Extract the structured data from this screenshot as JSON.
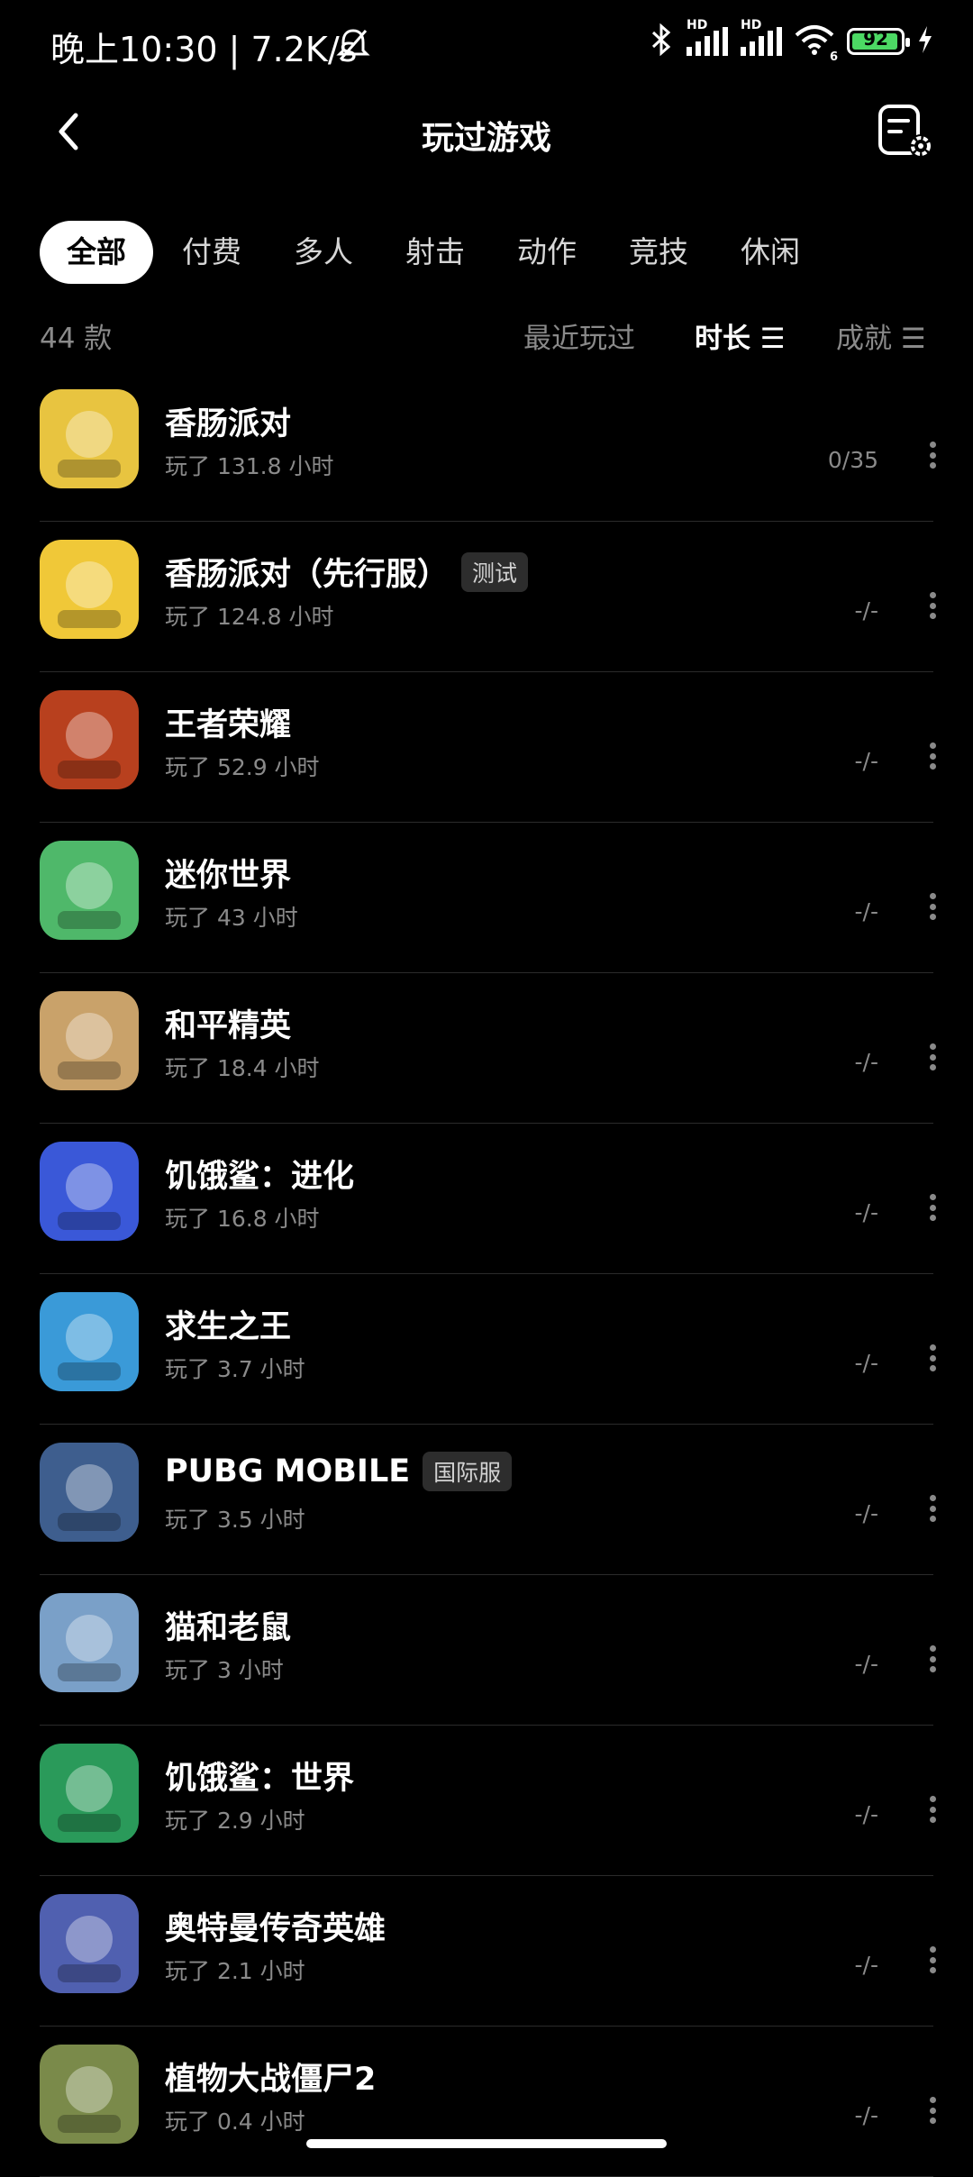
{
  "status_bar": {
    "time_speed": "晚上10:30 | 7.2K/s",
    "battery": "92",
    "signal_label": "HD",
    "wifi_label": "6"
  },
  "header": {
    "title": "玩过游戏",
    "back_icon": "chevron-left-icon",
    "settings_icon": "list-settings-icon"
  },
  "tabs": [
    "全部",
    "付费",
    "多人",
    "射击",
    "动作",
    "竞技",
    "休闲"
  ],
  "sort_bar": {
    "count": "44 款",
    "options": [
      "最近玩过",
      "时长 ☰",
      "成就 ☰"
    ]
  },
  "games": [
    {
      "name": "香肠派对",
      "badge": "",
      "time": "玩了 131.8 小时",
      "achievements": "0/35",
      "color": "#e8c440"
    },
    {
      "name": "香肠派对（先行服）",
      "badge": "测试",
      "time": "玩了 124.8 小时",
      "achievements": "-/-",
      "color": "#f0c838"
    },
    {
      "name": "王者荣耀",
      "badge": "",
      "time": "玩了 52.9 小时",
      "achievements": "-/-",
      "color": "#b8401e"
    },
    {
      "name": "迷你世界",
      "badge": "",
      "time": "玩了 43 小时",
      "achievements": "-/-",
      "color": "#4fb86a"
    },
    {
      "name": "和平精英",
      "badge": "",
      "time": "玩了 18.4 小时",
      "achievements": "-/-",
      "color": "#c9a26a"
    },
    {
      "name": "饥饿鲨：进化",
      "badge": "",
      "time": "玩了 16.8 小时",
      "achievements": "-/-",
      "color": "#3a58d8"
    },
    {
      "name": "求生之王",
      "badge": "",
      "time": "玩了 3.7 小时",
      "achievements": "-/-",
      "color": "#3a9ad8"
    },
    {
      "name": "PUBG MOBILE",
      "badge": "国际服",
      "time": "玩了 3.5 小时",
      "achievements": "-/-",
      "color": "#3e5e8e"
    },
    {
      "name": "猫和老鼠",
      "badge": "",
      "time": "玩了 3 小时",
      "achievements": "-/-",
      "color": "#7aa0c8"
    },
    {
      "name": "饥饿鲨：世界",
      "badge": "",
      "time": "玩了 2.9 小时",
      "achievements": "-/-",
      "color": "#2a9a5a"
    },
    {
      "name": "奥特曼传奇英雄",
      "badge": "",
      "time": "玩了 2.1 小时",
      "achievements": "-/-",
      "color": "#5060b0"
    },
    {
      "name": "植物大战僵尸2",
      "badge": "",
      "time": "玩了 0.4 小时",
      "achievements": "-/-",
      "color": "#7a8a4a"
    }
  ]
}
